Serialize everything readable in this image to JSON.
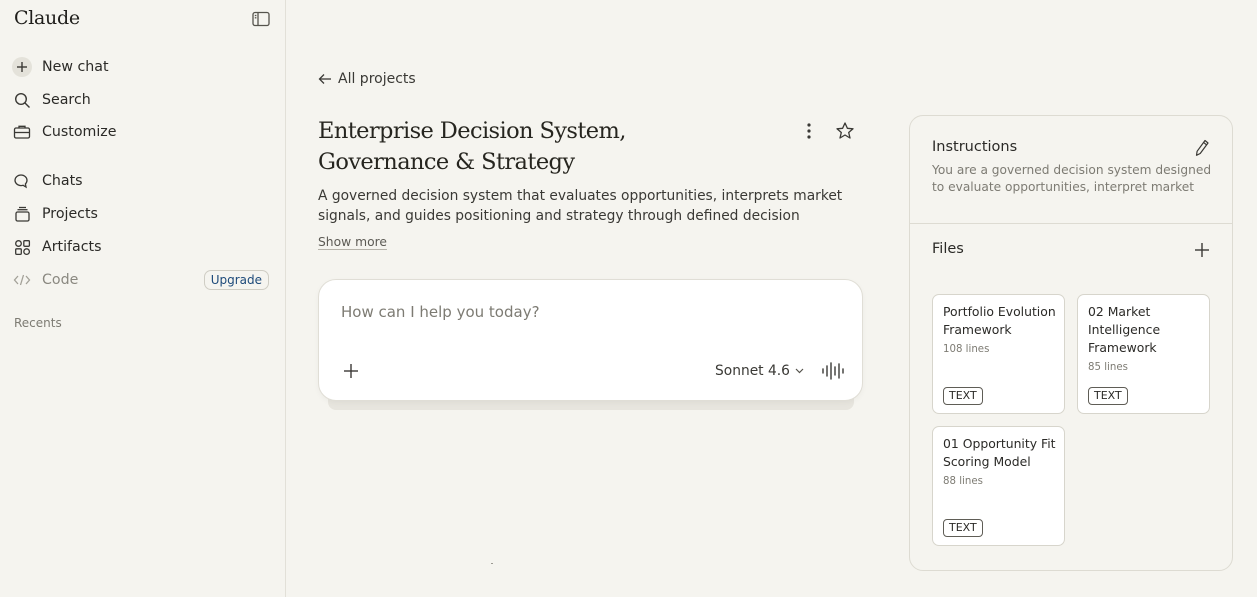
{
  "app": {
    "title": "Claude"
  },
  "sidebar": {
    "items": [
      {
        "label": "New chat",
        "icon": "plus-icon"
      },
      {
        "label": "Search",
        "icon": "search-icon"
      },
      {
        "label": "Customize",
        "icon": "briefcase-icon"
      },
      {
        "label": "Chats",
        "icon": "chat-bubbles-icon"
      },
      {
        "label": "Projects",
        "icon": "projects-stack-icon"
      },
      {
        "label": "Artifacts",
        "icon": "artifacts-grid-icon"
      },
      {
        "label": "Code",
        "icon": "code-icon"
      }
    ],
    "upgrade_label": "Upgrade",
    "recents_label": "Recents"
  },
  "main": {
    "back_label": "All projects",
    "project_title": "Enterprise Decision System, Governance & Strategy",
    "description": "A governed decision system that evaluates opportunities, interprets market signals, and guides positioning and strategy through defined decision authority,…",
    "show_more_label": "Show more",
    "composer": {
      "placeholder": "How can I help you today?",
      "model": "Sonnet 4.6"
    }
  },
  "panel": {
    "instructions_title": "Instructions",
    "instructions_text": "You are a governed decision system designed to evaluate opportunities, interpret market signal…",
    "files_title": "Files",
    "files": [
      {
        "name": "Portfolio Evolution Framework",
        "lines": "108 lines",
        "type": "TEXT"
      },
      {
        "name": "02 Market Intelligence Framework",
        "lines": "85 lines",
        "type": "TEXT"
      },
      {
        "name": "01 Opportunity Fit Scoring Model",
        "lines": "88 lines",
        "type": "TEXT"
      }
    ]
  },
  "colors": {
    "background": "#f5f4ef",
    "upgrade_text": "#1d4a7a",
    "card_background": "#ffffff"
  }
}
